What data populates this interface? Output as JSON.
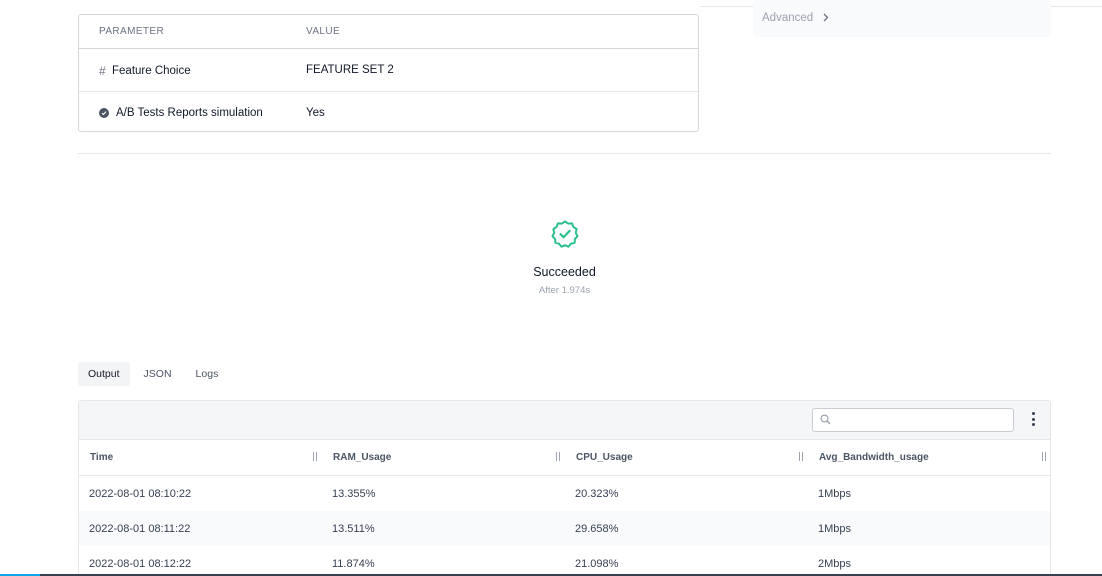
{
  "params_table": {
    "headers": {
      "parameter": "PARAMETER",
      "value": "VALUE"
    },
    "rows": [
      {
        "icon": "hash-icon",
        "name": "Feature Choice",
        "value": "FEATURE SET 2"
      },
      {
        "icon": "check-circle-icon",
        "name": "A/B Tests Reports simulation",
        "value": "Yes"
      }
    ]
  },
  "advanced": {
    "label": "Advanced"
  },
  "status": {
    "icon": "success-badge-icon",
    "title": "Succeeded",
    "subtitle": "After 1.974s",
    "color": "#2bbf8a"
  },
  "tabs": [
    {
      "label": "Output",
      "active": true
    },
    {
      "label": "JSON",
      "active": false
    },
    {
      "label": "Logs",
      "active": false
    }
  ],
  "output_grid": {
    "search": {
      "placeholder": "",
      "value": ""
    },
    "columns": [
      "Time",
      "RAM_Usage",
      "CPU_Usage",
      "Avg_Bandwidth_usage"
    ],
    "rows": [
      [
        "2022-08-01 08:10:22",
        "13.355%",
        "20.323%",
        "1Mbps"
      ],
      [
        "2022-08-01 08:11:22",
        "13.511%",
        "29.658%",
        "1Mbps"
      ],
      [
        "2022-08-01 08:12:22",
        "11.874%",
        "21.098%",
        "2Mbps"
      ]
    ]
  }
}
